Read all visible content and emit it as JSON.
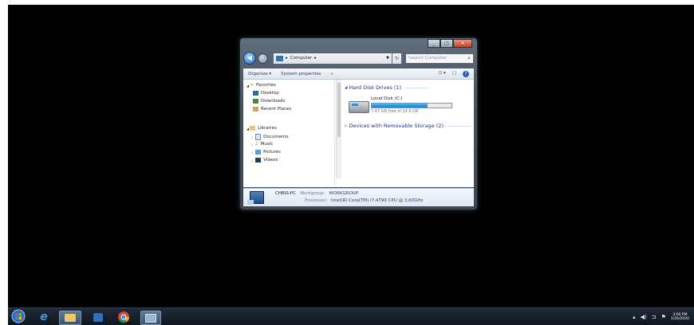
{
  "window": {
    "address": {
      "segments": [
        "Computer"
      ],
      "separator": "▸"
    },
    "search_placeholder": "Search Computer",
    "toolbar": {
      "organize": "Organize ▾",
      "system_properties": "System properties",
      "more": "»"
    },
    "nav": {
      "favorites": {
        "label": "Favorites",
        "items": [
          "Desktop",
          "Downloads",
          "Recent Places"
        ]
      },
      "libraries": {
        "label": "Libraries",
        "items": [
          "Documents",
          "Music",
          "Pictures",
          "Videos"
        ]
      }
    },
    "groups": {
      "hard_disk": "Hard Disk Drives (1)",
      "removable": "Devices with Removable Storage (2)"
    },
    "drive": {
      "name": "Local Disk (C:)",
      "free_text": "7.47 GB free of 24.8 GB",
      "used_fraction": 0.7
    },
    "details": {
      "computer_name": "CHRIS-PC",
      "workgroup_label": "Workgroup:",
      "workgroup_value": "WORKGROUP",
      "processor_label": "Processor:",
      "processor_value": "Intel(R) Core(TM) i7-4790 CPU @ 3.60GHz"
    }
  },
  "taskbar": {
    "apps": [
      "start-orb",
      "internet-explorer",
      "windows-explorer",
      "media-player",
      "chrome",
      "remote-desktop"
    ],
    "clock": {
      "time": "3:00 PM",
      "date": "1/26/2020"
    }
  },
  "colors": {
    "desktop": "#000000",
    "accent": "#1d7fd0"
  }
}
